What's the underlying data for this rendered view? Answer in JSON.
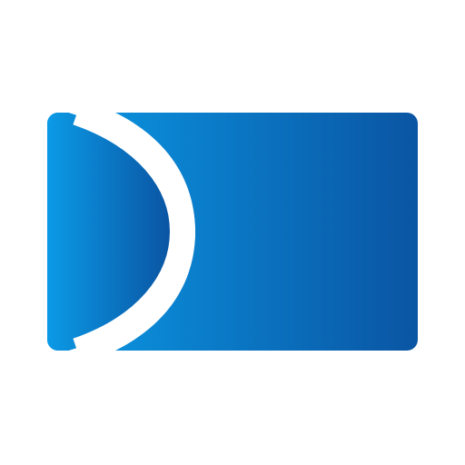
{
  "logo": {
    "name": "blue-card-arc-logo",
    "gradient_start": "#0B9AE6",
    "gradient_end": "#0A55A3",
    "arc_color": "#FFFFFF",
    "background": "#FFFFFF"
  }
}
